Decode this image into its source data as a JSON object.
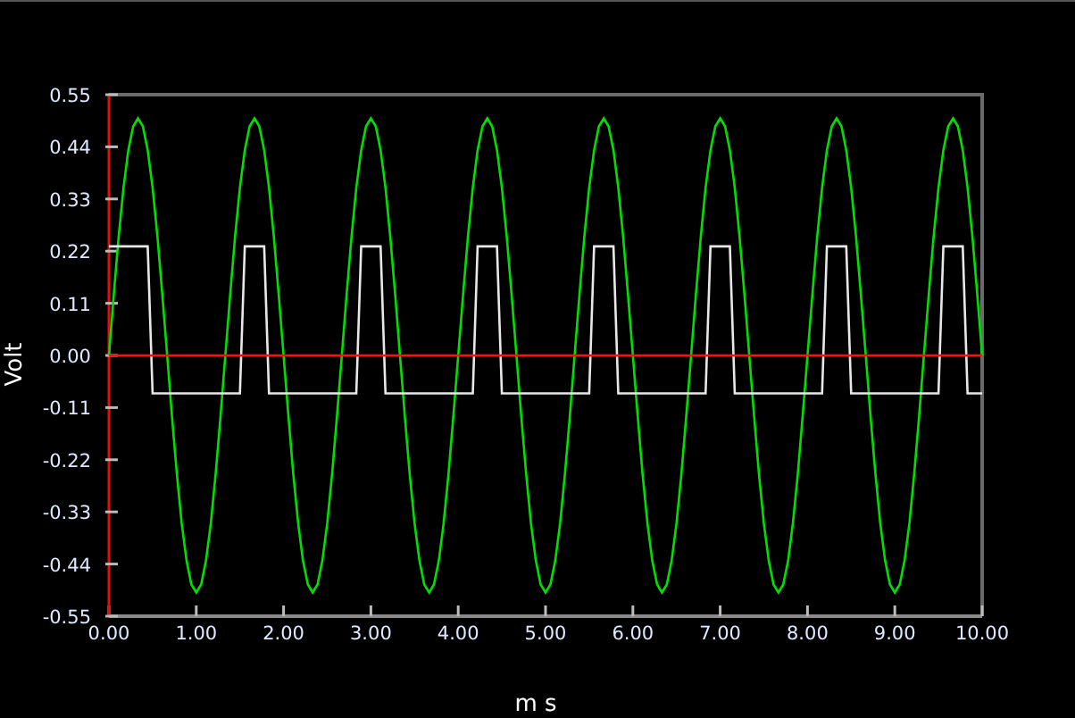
{
  "chart_data": {
    "type": "line",
    "xlabel": "m s",
    "ylabel": "Volt",
    "xlim": [
      0,
      10
    ],
    "ylim": [
      -0.55,
      0.55
    ],
    "xticks": [
      {
        "value": 0,
        "label": "0.00"
      },
      {
        "value": 1,
        "label": "1.00"
      },
      {
        "value": 2,
        "label": "2.00"
      },
      {
        "value": 3,
        "label": "3.00"
      },
      {
        "value": 4,
        "label": "4.00"
      },
      {
        "value": 5,
        "label": "5.00"
      },
      {
        "value": 6,
        "label": "6.00"
      },
      {
        "value": 7,
        "label": "7.00"
      },
      {
        "value": 8,
        "label": "8.00"
      },
      {
        "value": 9,
        "label": "9.00"
      },
      {
        "value": 10,
        "label": "10.00"
      }
    ],
    "yticks": [
      {
        "value": 0.55,
        "label": "0.55"
      },
      {
        "value": 0.44,
        "label": "0.44"
      },
      {
        "value": 0.33,
        "label": "0.33"
      },
      {
        "value": 0.22,
        "label": "0.22"
      },
      {
        "value": 0.11,
        "label": "0.11"
      },
      {
        "value": 0,
        "label": "0.00"
      },
      {
        "value": -0.11,
        "label": "-0.11"
      },
      {
        "value": -0.22,
        "label": "-0.22"
      },
      {
        "value": -0.33,
        "label": "-0.33"
      },
      {
        "value": -0.44,
        "label": "-0.44"
      },
      {
        "value": -0.55,
        "label": "-0.55"
      }
    ],
    "x": [
      0,
      0.056,
      0.111,
      0.167,
      0.222,
      0.278,
      0.333,
      0.389,
      0.444,
      0.5,
      0.556,
      0.611,
      0.667,
      0.722,
      0.778,
      0.833,
      0.889,
      0.944,
      1,
      1.056,
      1.111,
      1.167,
      1.222,
      1.278,
      1.333,
      1.389,
      1.444,
      1.5,
      1.556,
      1.611,
      1.667,
      1.722,
      1.778,
      1.833,
      1.889,
      1.944,
      2,
      2.056,
      2.111,
      2.167,
      2.222,
      2.278,
      2.333,
      2.389,
      2.444,
      2.5,
      2.556,
      2.611,
      2.667,
      2.722,
      2.778,
      2.833,
      2.889,
      2.944,
      3,
      3.056,
      3.111,
      3.167,
      3.222,
      3.278,
      3.333,
      3.389,
      3.444,
      3.5,
      3.556,
      3.611,
      3.667,
      3.722,
      3.778,
      3.833,
      3.889,
      3.944,
      4,
      4.056,
      4.111,
      4.167,
      4.222,
      4.278,
      4.333,
      4.389,
      4.444,
      4.5,
      4.556,
      4.611,
      4.667,
      4.722,
      4.778,
      4.833,
      4.889,
      4.944,
      5,
      5.056,
      5.111,
      5.167,
      5.222,
      5.278,
      5.333,
      5.389,
      5.444,
      5.5,
      5.556,
      5.611,
      5.667,
      5.722,
      5.778,
      5.833,
      5.889,
      5.944,
      6,
      6.056,
      6.111,
      6.167,
      6.222,
      6.278,
      6.333,
      6.389,
      6.444,
      6.5,
      6.556,
      6.611,
      6.667,
      6.722,
      6.778,
      6.833,
      6.889,
      6.944,
      7,
      7.056,
      7.111,
      7.167,
      7.222,
      7.278,
      7.333,
      7.389,
      7.444,
      7.5,
      7.556,
      7.611,
      7.667,
      7.722,
      7.778,
      7.833,
      7.889,
      7.944,
      8,
      8.056,
      8.111,
      8.167,
      8.222,
      8.278,
      8.333,
      8.389,
      8.444,
      8.5,
      8.556,
      8.611,
      8.667,
      8.722,
      8.778,
      8.833,
      8.889,
      8.944,
      9,
      9.056,
      9.111,
      9.167,
      9.222,
      9.278,
      9.333,
      9.389,
      9.444,
      9.5,
      9.556,
      9.611,
      9.667,
      9.722,
      9.778,
      9.833,
      9.889,
      9.944,
      10
    ],
    "series": [
      {
        "color": "#00e000",
        "values": [
          0,
          0.129,
          0.25,
          0.354,
          0.433,
          0.483,
          0.5,
          0.483,
          0.433,
          0.354,
          0.25,
          0.129,
          0,
          -0.129,
          -0.25,
          -0.354,
          -0.433,
          -0.483,
          -0.5,
          -0.483,
          -0.433,
          -0.354,
          -0.25,
          -0.129,
          0,
          0.129,
          0.25,
          0.354,
          0.433,
          0.483,
          0.5,
          0.483,
          0.433,
          0.354,
          0.25,
          0.129,
          0,
          -0.129,
          -0.25,
          -0.354,
          -0.433,
          -0.483,
          -0.5,
          -0.483,
          -0.433,
          -0.354,
          -0.25,
          -0.129,
          0,
          0.129,
          0.25,
          0.354,
          0.433,
          0.483,
          0.5,
          0.483,
          0.433,
          0.354,
          0.25,
          0.129,
          0,
          -0.129,
          -0.25,
          -0.354,
          -0.433,
          -0.483,
          -0.5,
          -0.483,
          -0.433,
          -0.354,
          -0.25,
          -0.129,
          0,
          0.129,
          0.25,
          0.354,
          0.433,
          0.483,
          0.5,
          0.483,
          0.433,
          0.354,
          0.25,
          0.129,
          0,
          -0.129,
          -0.25,
          -0.354,
          -0.433,
          -0.483,
          -0.5,
          -0.483,
          -0.433,
          -0.354,
          -0.25,
          -0.129,
          0,
          0.129,
          0.25,
          0.354,
          0.433,
          0.483,
          0.5,
          0.483,
          0.433,
          0.354,
          0.25,
          0.129,
          0,
          -0.129,
          -0.25,
          -0.354,
          -0.433,
          -0.483,
          -0.5,
          -0.483,
          -0.433,
          -0.354,
          -0.25,
          -0.129,
          0,
          0.129,
          0.25,
          0.354,
          0.433,
          0.483,
          0.5,
          0.483,
          0.433,
          0.354,
          0.25,
          0.129,
          0,
          -0.129,
          -0.25,
          -0.354,
          -0.433,
          -0.483,
          -0.5,
          -0.483,
          -0.433,
          -0.354,
          -0.25,
          -0.129,
          0,
          0.129,
          0.25,
          0.354,
          0.433,
          0.483,
          0.5,
          0.483,
          0.433,
          0.354,
          0.25,
          0.129,
          0,
          -0.129,
          -0.25,
          -0.354,
          -0.433,
          -0.483,
          -0.5,
          -0.483,
          -0.433,
          -0.354,
          -0.25,
          -0.129,
          0,
          0.129,
          0.25,
          0.354,
          0.433,
          0.483,
          0.5,
          0.483,
          0.433,
          0.354,
          0.25,
          0.129,
          0
        ]
      },
      {
        "color": "#e8e8e8",
        "values": [
          0.23,
          0.23,
          0.23,
          0.23,
          0.23,
          0.23,
          0.23,
          0.23,
          0.23,
          -0.08,
          -0.08,
          -0.08,
          -0.08,
          -0.08,
          -0.08,
          -0.08,
          -0.08,
          -0.08,
          -0.08,
          -0.08,
          -0.08,
          -0.08,
          -0.08,
          -0.08,
          -0.08,
          -0.08,
          -0.08,
          -0.08,
          0.23,
          0.23,
          0.23,
          0.23,
          0.23,
          -0.08,
          -0.08,
          -0.08,
          -0.08,
          -0.08,
          -0.08,
          -0.08,
          -0.08,
          -0.08,
          -0.08,
          -0.08,
          -0.08,
          -0.08,
          -0.08,
          -0.08,
          -0.08,
          -0.08,
          -0.08,
          -0.08,
          0.23,
          0.23,
          0.23,
          0.23,
          0.23,
          -0.08,
          -0.08,
          -0.08,
          -0.08,
          -0.08,
          -0.08,
          -0.08,
          -0.08,
          -0.08,
          -0.08,
          -0.08,
          -0.08,
          -0.08,
          -0.08,
          -0.08,
          -0.08,
          -0.08,
          -0.08,
          -0.08,
          0.23,
          0.23,
          0.23,
          0.23,
          0.23,
          -0.08,
          -0.08,
          -0.08,
          -0.08,
          -0.08,
          -0.08,
          -0.08,
          -0.08,
          -0.08,
          -0.08,
          -0.08,
          -0.08,
          -0.08,
          -0.08,
          -0.08,
          -0.08,
          -0.08,
          -0.08,
          -0.08,
          0.23,
          0.23,
          0.23,
          0.23,
          0.23,
          -0.08,
          -0.08,
          -0.08,
          -0.08,
          -0.08,
          -0.08,
          -0.08,
          -0.08,
          -0.08,
          -0.08,
          -0.08,
          -0.08,
          -0.08,
          -0.08,
          -0.08,
          -0.08,
          -0.08,
          -0.08,
          -0.08,
          0.23,
          0.23,
          0.23,
          0.23,
          0.23,
          -0.08,
          -0.08,
          -0.08,
          -0.08,
          -0.08,
          -0.08,
          -0.08,
          -0.08,
          -0.08,
          -0.08,
          -0.08,
          -0.08,
          -0.08,
          -0.08,
          -0.08,
          -0.08,
          -0.08,
          -0.08,
          -0.08,
          0.23,
          0.23,
          0.23,
          0.23,
          0.23,
          -0.08,
          -0.08,
          -0.08,
          -0.08,
          -0.08,
          -0.08,
          -0.08,
          -0.08,
          -0.08,
          -0.08,
          -0.08,
          -0.08,
          -0.08,
          -0.08,
          -0.08,
          -0.08,
          -0.08,
          -0.08,
          -0.08,
          0.23,
          0.23,
          0.23,
          0.23,
          0.23,
          -0.08,
          -0.08,
          -0.08,
          -0.08
        ]
      },
      {
        "color": "#ff1010",
        "values": [
          0,
          0,
          0,
          0,
          0,
          0,
          0,
          0,
          0,
          0,
          0,
          0,
          0,
          0,
          0,
          0,
          0,
          0,
          0,
          0,
          0,
          0,
          0,
          0,
          0,
          0,
          0,
          0,
          0,
          0,
          0,
          0,
          0,
          0,
          0,
          0,
          0,
          0,
          0,
          0,
          0,
          0,
          0,
          0,
          0,
          0,
          0,
          0,
          0,
          0,
          0,
          0,
          0,
          0,
          0,
          0,
          0,
          0,
          0,
          0,
          0,
          0,
          0,
          0,
          0,
          0,
          0,
          0,
          0,
          0,
          0,
          0,
          0,
          0,
          0,
          0,
          0,
          0,
          0,
          0,
          0,
          0,
          0,
          0,
          0,
          0,
          0,
          0,
          0,
          0,
          0,
          0,
          0,
          0,
          0,
          0,
          0,
          0,
          0,
          0,
          0,
          0,
          0,
          0,
          0,
          0,
          0,
          0,
          0,
          0,
          0,
          0,
          0,
          0,
          0,
          0,
          0,
          0,
          0,
          0,
          0,
          0,
          0,
          0,
          0,
          0,
          0,
          0,
          0,
          0,
          0,
          0,
          0,
          0,
          0,
          0,
          0,
          0,
          0,
          0,
          0,
          0,
          0,
          0,
          0,
          0,
          0,
          0,
          0,
          0,
          0,
          0,
          0,
          0,
          0,
          0,
          0,
          0,
          0,
          0,
          0,
          0,
          0,
          0,
          0,
          0,
          0,
          0,
          0,
          0,
          0,
          0,
          0,
          0,
          0,
          0,
          0,
          0,
          0,
          0,
          0
        ]
      }
    ]
  }
}
